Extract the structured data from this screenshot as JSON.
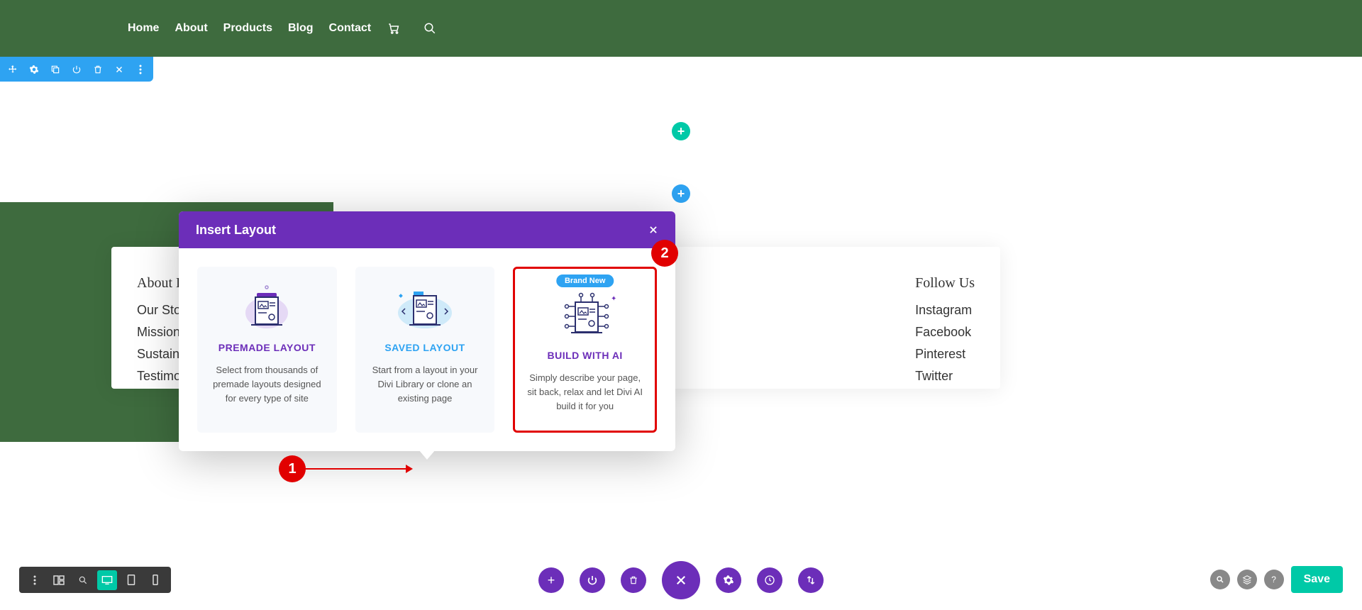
{
  "header": {
    "nav": [
      "Home",
      "About",
      "Products",
      "Blog",
      "Contact"
    ]
  },
  "footer_card": {
    "left_title": "About H",
    "left_links": [
      "Our Stor",
      "Mission",
      "Sustaina",
      "Testimo"
    ],
    "right_title": "Follow Us",
    "right_links": [
      "Instagram",
      "Facebook",
      "Pinterest",
      "Twitter"
    ]
  },
  "modal": {
    "title": "Insert Layout",
    "options": [
      {
        "heading": "PREMADE LAYOUT",
        "desc": "Select from thousands of premade layouts designed for every type of site"
      },
      {
        "heading": "SAVED LAYOUT",
        "desc": "Start from a layout in your Divi Library or clone an existing page"
      },
      {
        "badge": "Brand New",
        "heading": "BUILD WITH AI",
        "desc": "Simply describe your page, sit back, relax and let Divi AI build it for you"
      }
    ]
  },
  "annotations": {
    "marker1": "1",
    "marker2": "2"
  },
  "save_label": "Save"
}
